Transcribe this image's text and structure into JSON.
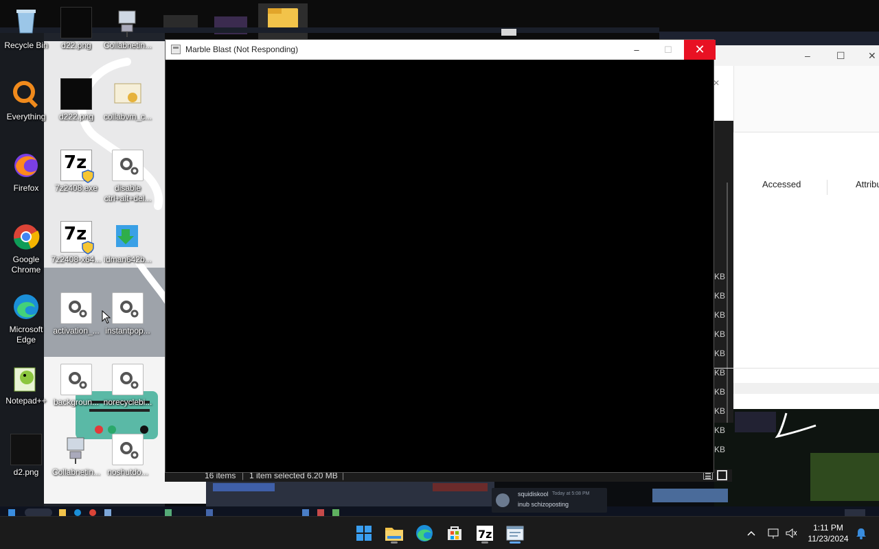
{
  "desktop": {
    "icons": [
      {
        "label": "Recycle Bin"
      },
      {
        "label": "d22.png"
      },
      {
        "label": "Collabnetin..."
      },
      {
        "label": "Everything"
      },
      {
        "label": "d222.png"
      },
      {
        "label": "collabvm_c..."
      },
      {
        "label": "Firefox"
      },
      {
        "label": "7z2408.exe"
      },
      {
        "label": "disable ctrl+alt+del..."
      },
      {
        "label": "Google Chrome"
      },
      {
        "label": "7z2408-x64..."
      },
      {
        "label": "idman642b..."
      },
      {
        "label": "Microsoft Edge"
      },
      {
        "label": "activation_..."
      },
      {
        "label": "instantpop..."
      },
      {
        "label": "Notepad++"
      },
      {
        "label": "backgroun..."
      },
      {
        "label": "norecyclebi..."
      },
      {
        "label": "d2.png"
      },
      {
        "label": "Collabnetin..."
      },
      {
        "label": "noshutdo..."
      }
    ]
  },
  "marble_window": {
    "title": "Marble Blast (Not Responding)",
    "minimize": "–",
    "maximize": "☐",
    "close": "✕"
  },
  "explorer_bg": {
    "columns": [
      "Accessed",
      "Attribu"
    ],
    "kb_labels": [
      "KB",
      "KB",
      "KB",
      "KB",
      "KB",
      "KB",
      "KB",
      "KB",
      "KB",
      "KB"
    ],
    "status": {
      "items": "16 items",
      "selected": "1 item selected  6.20 MB",
      "sep": "|"
    }
  },
  "notification": {
    "user": "squidiskool",
    "time": "Today at 5:08 PM",
    "message": "inub schizoposting"
  },
  "taskbar": {
    "time": "1:11 PM",
    "date": "11/23/2024"
  },
  "colors": {
    "close_red": "#e81123",
    "taskbar_bg": "#1b1b1b",
    "win_blue": "#3a8dde"
  }
}
